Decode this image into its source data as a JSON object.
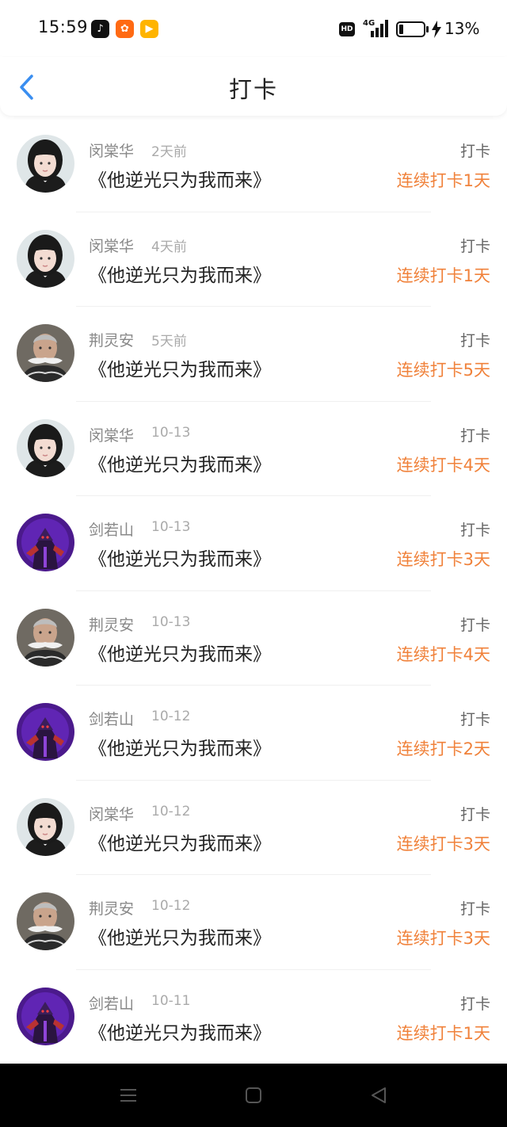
{
  "status_bar": {
    "time": "15:59",
    "network": "4G",
    "hd_label": "HD",
    "battery": "13%",
    "apps": [
      "tiktok-icon",
      "kuaishou-icon",
      "video-icon"
    ]
  },
  "header": {
    "title": "打卡",
    "back_icon": "chevron-left-icon"
  },
  "rows": [
    {
      "name": "闵棠华",
      "time": "2天前",
      "book": "《他逆光只为我而来》",
      "action": "打卡",
      "streak": "连续打卡1天",
      "avatar": "girl"
    },
    {
      "name": "闵棠华",
      "time": "4天前",
      "book": "《他逆光只为我而来》",
      "action": "打卡",
      "streak": "连续打卡1天",
      "avatar": "girl"
    },
    {
      "name": "荆灵安",
      "time": "5天前",
      "book": "《他逆光只为我而来》",
      "action": "打卡",
      "streak": "连续打卡5天",
      "avatar": "oldman"
    },
    {
      "name": "闵棠华",
      "time": "10-13",
      "book": "《他逆光只为我而来》",
      "action": "打卡",
      "streak": "连续打卡4天",
      "avatar": "girl"
    },
    {
      "name": "剑若山",
      "time": "10-13",
      "book": "《他逆光只为我而来》",
      "action": "打卡",
      "streak": "连续打卡3天",
      "avatar": "warrior"
    },
    {
      "name": "荆灵安",
      "time": "10-13",
      "book": "《他逆光只为我而来》",
      "action": "打卡",
      "streak": "连续打卡4天",
      "avatar": "oldman"
    },
    {
      "name": "剑若山",
      "time": "10-12",
      "book": "《他逆光只为我而来》",
      "action": "打卡",
      "streak": "连续打卡2天",
      "avatar": "warrior"
    },
    {
      "name": "闵棠华",
      "time": "10-12",
      "book": "《他逆光只为我而来》",
      "action": "打卡",
      "streak": "连续打卡3天",
      "avatar": "girl"
    },
    {
      "name": "荆灵安",
      "time": "10-12",
      "book": "《他逆光只为我而来》",
      "action": "打卡",
      "streak": "连续打卡3天",
      "avatar": "oldman"
    },
    {
      "name": "剑若山",
      "time": "10-11",
      "book": "《他逆光只为我而来》",
      "action": "打卡",
      "streak": "连续打卡1天",
      "avatar": "warrior"
    }
  ],
  "colors": {
    "accent": "#f0823b",
    "back": "#3a8ef0",
    "name": "#888888",
    "text": "#222222"
  },
  "nav": {
    "icons": [
      "menu-icon",
      "home-square-icon",
      "back-triangle-icon"
    ]
  }
}
